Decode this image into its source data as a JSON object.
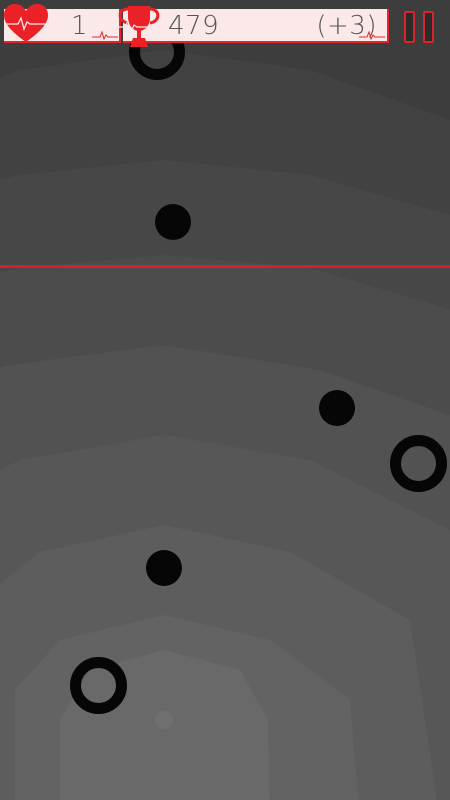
{
  "hud": {
    "lives": "1",
    "score": "479",
    "bonus": "(+3)"
  },
  "icons": {
    "heart": "heart-icon",
    "trophy": "trophy-icon",
    "pause": "pause-icon"
  },
  "colors": {
    "accent": "#e0262b",
    "panel": "#fbe9ea",
    "background": "#3d3d3d",
    "pieces": "#060606"
  }
}
